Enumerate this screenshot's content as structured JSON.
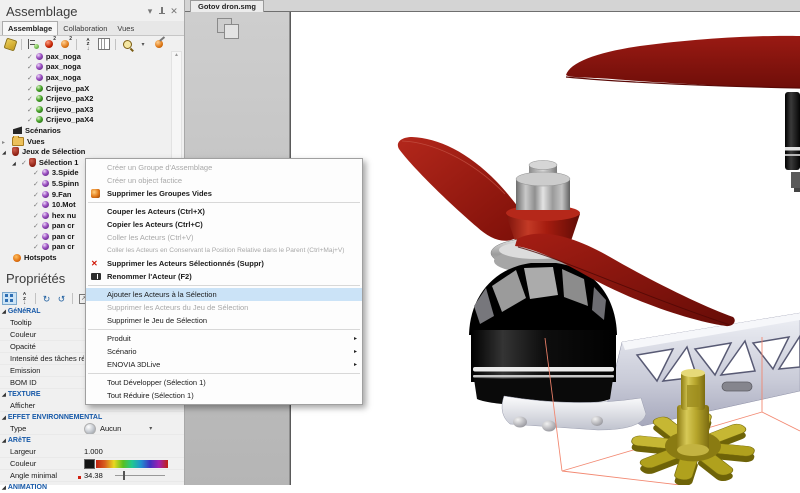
{
  "left_panel": {
    "title": "Assemblage",
    "window_icons": [
      "chevron-down-icon",
      "pin-icon",
      "close-icon"
    ],
    "tabs": [
      {
        "label": "Assemblage",
        "active": true
      },
      {
        "label": "Collaboration",
        "active": false
      },
      {
        "label": "Vues",
        "active": false
      }
    ],
    "toolbar_icons": [
      "import-workshop-icon",
      "actor-tree-icon",
      "red-actors-count-icon",
      "orange-actors-count-icon",
      "sort-alpha-icon",
      "columns-icon",
      "search-actor-icon",
      "dropdown-caret-icon",
      "edit-actor-icon"
    ],
    "tree": [
      {
        "label": "pax_noga",
        "checked": true,
        "icon": "sphere-purple"
      },
      {
        "label": "pax_noga",
        "checked": true,
        "icon": "sphere-purple"
      },
      {
        "label": "pax_noga",
        "checked": true,
        "icon": "sphere-purple"
      },
      {
        "label": "Crijevo_paX",
        "checked": true,
        "icon": "sphere-green"
      },
      {
        "label": "Crijevo_paX2",
        "checked": true,
        "icon": "sphere-green"
      },
      {
        "label": "Crijevo_paX3",
        "checked": true,
        "icon": "sphere-green"
      },
      {
        "label": "Crijevo_paX4",
        "checked": true,
        "icon": "sphere-green"
      },
      {
        "label": "Scénarios",
        "icon": "scenarios-icon"
      },
      {
        "label": "Vues",
        "icon": "folder-icon",
        "expander": "collapsed"
      },
      {
        "label": "Jeux de Sélection",
        "icon": "selection-set-icon",
        "expander": "expanded"
      },
      {
        "label": "Sélection 1",
        "checked": true,
        "icon": "selection-set-icon",
        "expander": "expanded"
      },
      {
        "label": "3.Spide",
        "checked": true,
        "icon": "sphere-purple"
      },
      {
        "label": "5.Spinn",
        "checked": true,
        "icon": "sphere-purple"
      },
      {
        "label": "9.Fan",
        "checked": true,
        "icon": "sphere-purple"
      },
      {
        "label": "10.Mot",
        "checked": true,
        "icon": "sphere-purple"
      },
      {
        "label": "hex nu",
        "checked": true,
        "icon": "sphere-purple"
      },
      {
        "label": "pan cr",
        "checked": true,
        "icon": "sphere-purple"
      },
      {
        "label": "pan cr",
        "checked": true,
        "icon": "sphere-purple"
      },
      {
        "label": "pan cr",
        "checked": true,
        "icon": "sphere-purple"
      },
      {
        "label": "Hotspots",
        "icon": "hotspots-icon"
      }
    ]
  },
  "properties": {
    "title": "Propriétés",
    "toolbar_icons": [
      "categorized-icon",
      "sort-alpha-icon",
      "reset-properties-icon",
      "refresh-icon",
      "popout-icon"
    ],
    "rows": [
      {
        "label": "GéNéRAL",
        "type": "section"
      },
      {
        "label": "Tooltip",
        "value": ""
      },
      {
        "label": "Couleur",
        "value": ""
      },
      {
        "label": "Opacité",
        "value": ""
      },
      {
        "label": "Intensité des tâches réfl",
        "value": ""
      },
      {
        "label": "Emission",
        "value": ""
      },
      {
        "label": "BOM ID",
        "value": ""
      },
      {
        "label": "TEXTURE",
        "type": "section"
      },
      {
        "label": "Afficher",
        "value": ""
      },
      {
        "label": "EFFET ENVIRONNEMENTAL",
        "type": "section"
      },
      {
        "label": "Type",
        "value": "Aucun"
      },
      {
        "label": "ARêTE",
        "type": "section"
      },
      {
        "label": "Largeur",
        "value": "1.000"
      },
      {
        "label": "Couleur",
        "value": ""
      },
      {
        "label": "Angle minimal",
        "value": "34.38"
      },
      {
        "label": "ANIMATION",
        "type": "section"
      }
    ]
  },
  "document": {
    "tab_label": "Gotov dron.smg"
  },
  "context_menu": {
    "items": [
      {
        "label": "Créer un Groupe d'Assemblage",
        "state": "disabled"
      },
      {
        "label": "Créer un object factice",
        "state": "disabled"
      },
      {
        "label": "Supprimer les Groupes Vides",
        "state": "normal",
        "icon": "delete-empty-groups-icon"
      },
      {
        "label": "Couper les Acteurs (Ctrl+X)",
        "state": "normal"
      },
      {
        "label": "Copier les Acteurs (Ctrl+C)",
        "state": "normal"
      },
      {
        "label": "Coller les Acteurs (Ctrl+V)",
        "state": "disabled"
      },
      {
        "label": "Coller les Acteurs en Conservant la Position Relative dans le Parent (Ctrl+Maj+V)",
        "state": "disabled"
      },
      {
        "label": "Supprimer les Acteurs Sélectionnés (Suppr)",
        "state": "normal",
        "icon": "delete-icon"
      },
      {
        "label": "Renommer l'Acteur (F2)",
        "state": "normal",
        "icon": "rename-icon"
      },
      {
        "label": "Ajouter les Acteurs à la Sélection",
        "state": "highlighted"
      },
      {
        "label": "Supprimer les Acteurs du Jeu de Sélection",
        "state": "disabled"
      },
      {
        "label": "Supprimer le Jeu de Sélection",
        "state": "normal"
      },
      {
        "label": "Produit",
        "state": "normal",
        "submenu": true
      },
      {
        "label": "Scénario",
        "state": "normal",
        "submenu": true
      },
      {
        "label": "ENOVIA 3DLive",
        "state": "normal",
        "submenu": true
      },
      {
        "label": "Tout Développer (Sélection 1)",
        "state": "normal"
      },
      {
        "label": "Tout Réduire (Sélection 1)",
        "state": "normal"
      }
    ]
  },
  "viewport": {
    "parts": [
      "red-propeller",
      "hex-nut",
      "bearing",
      "motor-bell",
      "motor-mount",
      "frame-arm",
      "spider-coupling",
      "selection-bounding-box",
      "second-motor",
      "second-propeller"
    ],
    "colors": {
      "propeller": "#8f1712",
      "motor": "#0a0a0a",
      "arm": "#ccced9",
      "coupling": "#b0a11d",
      "selection_box": "#f2836b"
    }
  }
}
